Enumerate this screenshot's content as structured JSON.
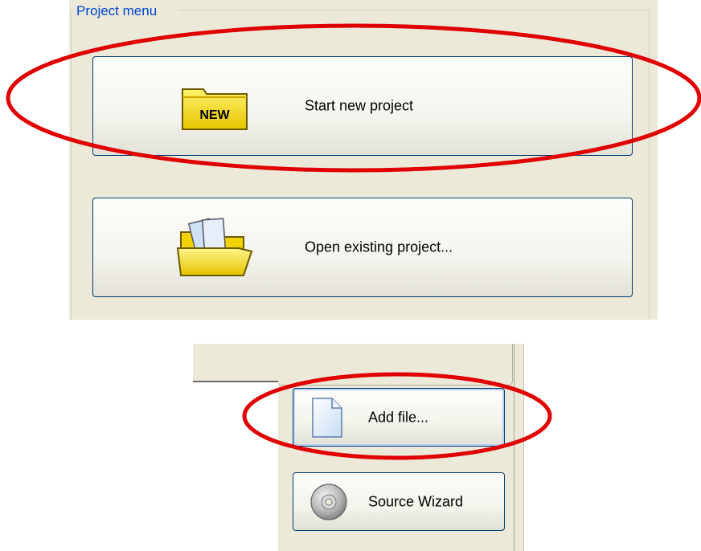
{
  "project_menu": {
    "title": "Project menu",
    "new_project": {
      "label": "Start new project",
      "icon": "new-folder-icon",
      "icon_text": "NEW"
    },
    "open_project": {
      "label": "Open existing project...",
      "icon": "open-folder-icon"
    }
  },
  "source_panel": {
    "add_file": {
      "label": "Add file...",
      "icon": "document-icon"
    },
    "source_wizard": {
      "label": "Source Wizard",
      "icon": "cd-icon"
    }
  },
  "colors": {
    "annotation": "#e00000",
    "panel_background": "#ece9d8",
    "group_title": "#0046d5",
    "button_border": "#003c74"
  }
}
